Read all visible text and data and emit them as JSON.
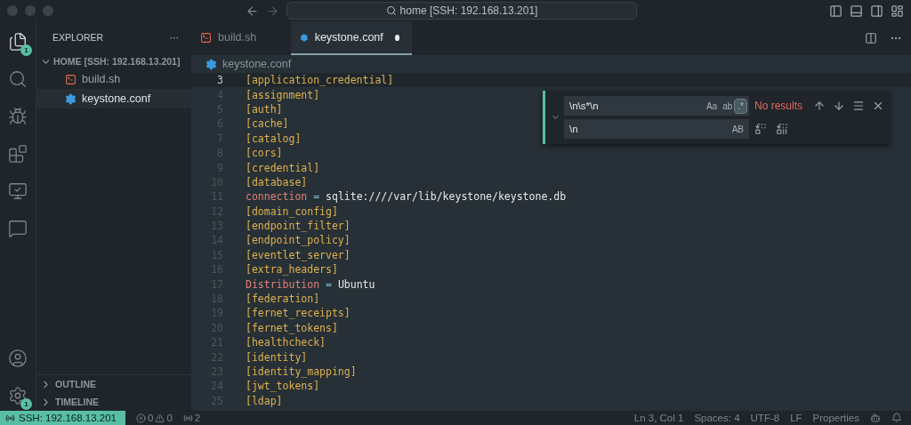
{
  "title_bar": {
    "search": "home [SSH: 192.168.13.201]"
  },
  "activity_bar": {
    "top": [
      {
        "kind": "files",
        "selected": true,
        "badge": "1"
      },
      {
        "kind": "search",
        "selected": false
      },
      {
        "kind": "debug",
        "selected": false
      },
      {
        "kind": "extensions",
        "selected": false
      },
      {
        "kind": "remote",
        "selected": false
      },
      {
        "kind": "comments",
        "selected": false
      }
    ],
    "bottom": [
      {
        "kind": "account",
        "selected": false
      },
      {
        "kind": "settings",
        "selected": false,
        "badge": "1"
      }
    ]
  },
  "sidebar": {
    "title": "EXPLORER",
    "more": "···",
    "folder": {
      "label": "HOME [SSH: 192.168.13.201]",
      "expanded": true,
      "children": [
        {
          "label": "build.sh",
          "kind": "shell",
          "selected": false
        },
        {
          "label": "keystone.conf",
          "kind": "config",
          "selected": true
        }
      ]
    },
    "sections": [
      {
        "label": "OUTLINE",
        "expanded": false
      },
      {
        "label": "TIMELINE",
        "expanded": false
      }
    ]
  },
  "tabs": [
    {
      "label": "build.sh",
      "kind": "shell",
      "selected": false,
      "modified": false
    },
    {
      "label": "keystone.conf",
      "kind": "config",
      "selected": true,
      "modified": true
    }
  ],
  "breadcrumb": {
    "label": "keystone.conf",
    "kind": "config"
  },
  "editor": {
    "lines": [
      {
        "number": "3",
        "kind": "section",
        "text": "[application_credential]",
        "current": true
      },
      {
        "number": "4",
        "kind": "section",
        "text": "[assignment]",
        "current": false
      },
      {
        "number": "5",
        "kind": "section",
        "text": "[auth]",
        "current": false
      },
      {
        "number": "6",
        "kind": "section",
        "text": "[cache]",
        "current": false
      },
      {
        "number": "7",
        "kind": "section",
        "text": "[catalog]",
        "current": false
      },
      {
        "number": "8",
        "kind": "section",
        "text": "[cors]",
        "current": false
      },
      {
        "number": "9",
        "kind": "section",
        "text": "[credential]",
        "current": false
      },
      {
        "number": "10",
        "kind": "section",
        "text": "[database]",
        "current": false
      },
      {
        "number": "11",
        "kind": "keyvalue",
        "key": "connection",
        "op": "=",
        "value": "sqlite:////var/lib/keystone/keystone.db",
        "current": false
      },
      {
        "number": "12",
        "kind": "section",
        "text": "[domain_config]",
        "current": false
      },
      {
        "number": "13",
        "kind": "section",
        "text": "[endpoint_filter]",
        "current": false
      },
      {
        "number": "14",
        "kind": "section",
        "text": "[endpoint_policy]",
        "current": false
      },
      {
        "number": "15",
        "kind": "section",
        "text": "[eventlet_server]",
        "current": false
      },
      {
        "number": "16",
        "kind": "section",
        "text": "[extra_headers]",
        "current": false
      },
      {
        "number": "17",
        "kind": "keyvalue",
        "key": "Distribution",
        "op": "=",
        "value": "Ubuntu",
        "current": false
      },
      {
        "number": "18",
        "kind": "section",
        "text": "[federation]",
        "current": false
      },
      {
        "number": "19",
        "kind": "section",
        "text": "[fernet_receipts]",
        "current": false
      },
      {
        "number": "20",
        "kind": "section",
        "text": "[fernet_tokens]",
        "current": false
      },
      {
        "number": "21",
        "kind": "section",
        "text": "[healthcheck]",
        "current": false
      },
      {
        "number": "22",
        "kind": "section",
        "text": "[identity]",
        "current": false
      },
      {
        "number": "23",
        "kind": "section",
        "text": "[identity_mapping]",
        "current": false
      },
      {
        "number": "24",
        "kind": "section",
        "text": "[jwt_tokens]",
        "current": false
      },
      {
        "number": "25",
        "kind": "section",
        "text": "[ldap]",
        "current": false
      }
    ]
  },
  "find_widget": {
    "find_value": "\\n\\s*\\n",
    "options": [
      {
        "label": "Aa",
        "selected": false
      },
      {
        "label": "ab",
        "selected": false
      },
      {
        "label": ".*",
        "selected": true
      }
    ],
    "result": "No results",
    "replace_value": "\\n",
    "preserve_case": "AB"
  },
  "status_bar": {
    "remote": "SSH: 192.168.13.201",
    "errors": "0",
    "warnings": "0",
    "ports": "2",
    "right": [
      "Ln 3, Col 1",
      "Spaces: 4",
      "UTF-8",
      "LF",
      "Properties"
    ]
  }
}
